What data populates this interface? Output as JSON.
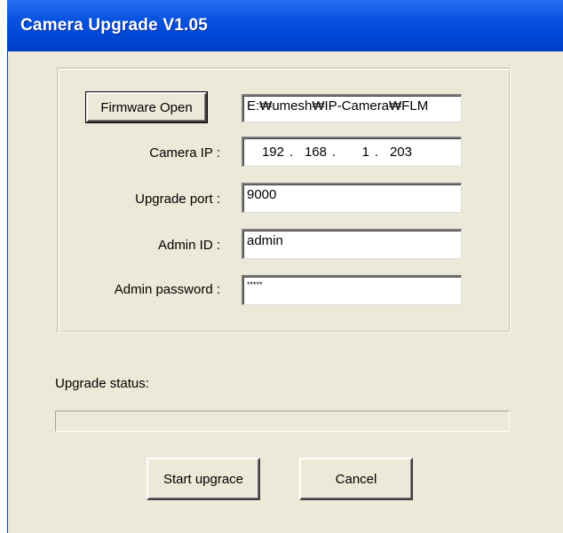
{
  "window": {
    "title": "Camera Upgrade V1.05"
  },
  "form": {
    "firmware_button": "Firmware Open",
    "firmware_path": "E:₩umesh₩IP-Camera₩FLM",
    "camera_ip_label": "Camera IP :",
    "camera_ip": [
      "192",
      "168",
      "1",
      "203"
    ],
    "ip_dot": ".",
    "upgrade_port_label": "Upgrade port :",
    "upgrade_port": "9000",
    "admin_id_label": "Admin ID :",
    "admin_id": "admin",
    "admin_password_label": "Admin password :",
    "admin_password": "*****"
  },
  "status": {
    "label": "Upgrade status:",
    "progress": 0
  },
  "buttons": {
    "start": "Start upgrace",
    "cancel": "Cancel"
  }
}
